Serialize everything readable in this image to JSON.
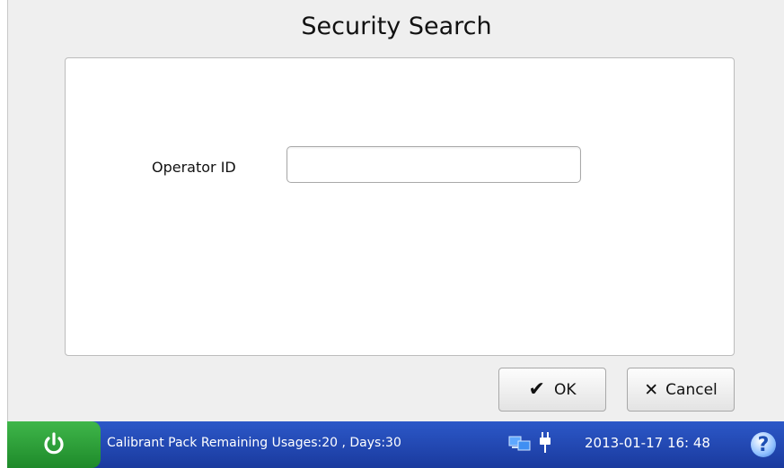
{
  "dialog": {
    "title": "Security Search",
    "operator_label": "Operator ID",
    "operator_value": "",
    "operator_placeholder": ""
  },
  "buttons": {
    "ok_icon": "check-icon",
    "ok_glyph": "✔",
    "ok_label": "OK",
    "cancel_icon": "x-icon",
    "cancel_glyph": "✕",
    "cancel_label": "Cancel"
  },
  "taskbar": {
    "power_icon": "power-icon",
    "status_text": "Calibrant Pack Remaining Usages:20 , Days:30",
    "network_icon": "network-icon",
    "plug_icon": "plug-icon",
    "datetime": "2013-01-17  16: 48",
    "help_icon": "help-icon",
    "help_glyph": "?"
  },
  "colors": {
    "taskbar": "#1f43ad",
    "power_button": "#2e9e3a",
    "window_bg": "#efefef"
  }
}
